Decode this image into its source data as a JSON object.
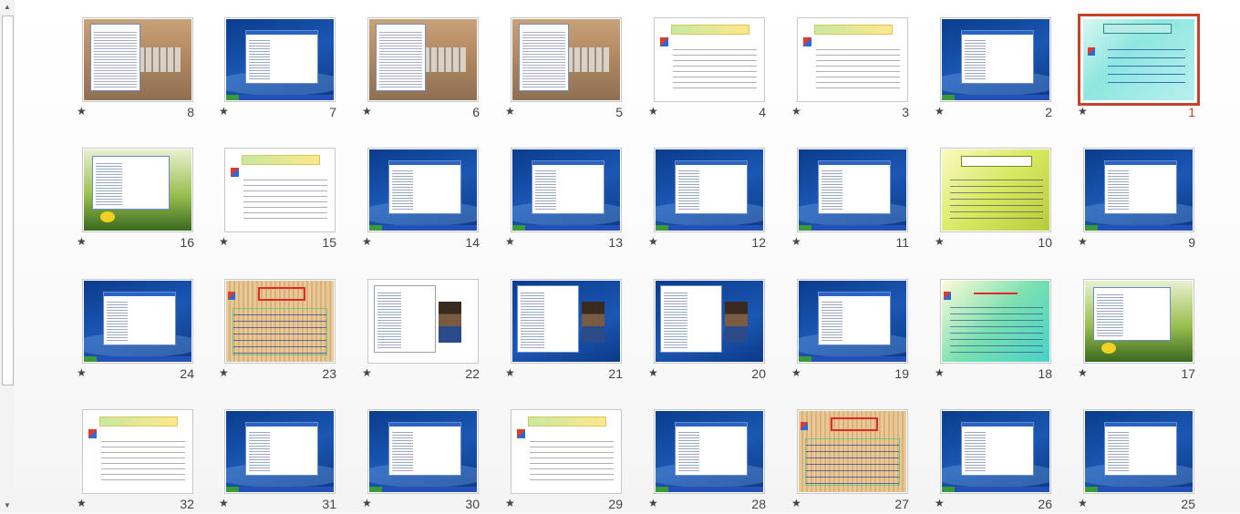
{
  "slide_sorter": {
    "selected_slide": 1,
    "star_symbol": "★",
    "slides": [
      {
        "number": "1",
        "kind": "cyan"
      },
      {
        "number": "2",
        "kind": "blue"
      },
      {
        "number": "3",
        "kind": "text"
      },
      {
        "number": "4",
        "kind": "text"
      },
      {
        "number": "5",
        "kind": "photo"
      },
      {
        "number": "6",
        "kind": "photo"
      },
      {
        "number": "7",
        "kind": "blue"
      },
      {
        "number": "8",
        "kind": "photo"
      },
      {
        "number": "9",
        "kind": "blue"
      },
      {
        "number": "10",
        "kind": "yellow"
      },
      {
        "number": "11",
        "kind": "blue"
      },
      {
        "number": "12",
        "kind": "blue"
      },
      {
        "number": "13",
        "kind": "blue"
      },
      {
        "number": "14",
        "kind": "blue"
      },
      {
        "number": "15",
        "kind": "text"
      },
      {
        "number": "16",
        "kind": "flower"
      },
      {
        "number": "17",
        "kind": "flower"
      },
      {
        "number": "18",
        "kind": "green"
      },
      {
        "number": "19",
        "kind": "blue"
      },
      {
        "number": "20",
        "kind": "photoperson"
      },
      {
        "number": "21",
        "kind": "photoperson"
      },
      {
        "number": "22",
        "kind": "photoperson-white"
      },
      {
        "number": "23",
        "kind": "wood"
      },
      {
        "number": "24",
        "kind": "blue"
      },
      {
        "number": "25",
        "kind": "blue"
      },
      {
        "number": "26",
        "kind": "blue"
      },
      {
        "number": "27",
        "kind": "wood"
      },
      {
        "number": "28",
        "kind": "blue"
      },
      {
        "number": "29",
        "kind": "text"
      },
      {
        "number": "30",
        "kind": "blue"
      },
      {
        "number": "31",
        "kind": "blue"
      },
      {
        "number": "32",
        "kind": "text"
      }
    ]
  },
  "scrollbar": {
    "up_arrow": "▲",
    "down_arrow": "▼"
  },
  "colors": {
    "selection_border": "#c8412a",
    "number_text": "#444444"
  }
}
